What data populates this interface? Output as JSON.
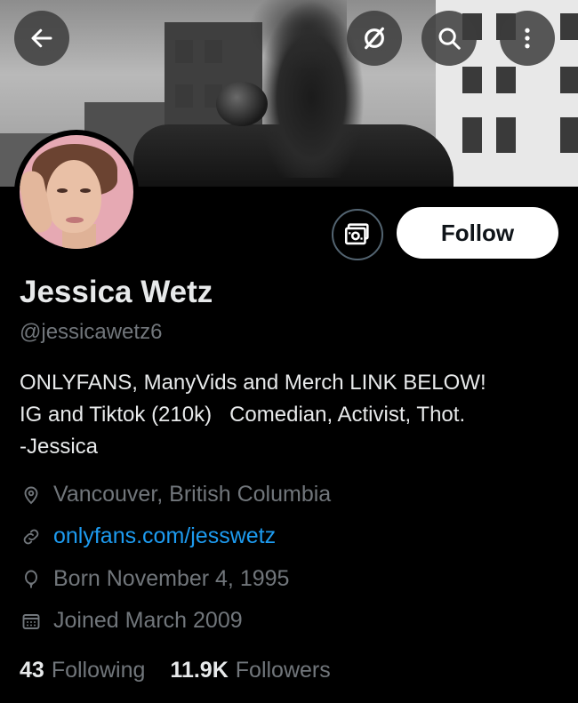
{
  "header": {
    "back_icon": "arrow-left-icon",
    "grok_icon": "slashed-circle-icon",
    "search_icon": "search-icon",
    "more_icon": "more-vertical-icon"
  },
  "actions": {
    "subscribe_icon": "money-ticket-icon",
    "follow_label": "Follow"
  },
  "profile": {
    "name": "Jessica Wetz",
    "handle": "@jessicawetz6",
    "bio": [
      "ONLYFANS, ManyVids and Merch LINK BELOW!",
      "IG and Tiktok (210k)   Comedian, Activist, Thot.",
      "-Jessica"
    ],
    "location": "Vancouver, British Columbia",
    "website": "onlyfans.com/jesswetz",
    "birthday": "Born November 4, 1995",
    "joined": "Joined March 2009"
  },
  "stats": {
    "following_count": "43",
    "following_label": "Following",
    "followers_count": "11.9K",
    "followers_label": "Followers"
  },
  "colors": {
    "background": "#000000",
    "text": "#e7e9ea",
    "muted": "#71767b",
    "link": "#1d9bf0",
    "follow_bg": "#ffffff"
  }
}
